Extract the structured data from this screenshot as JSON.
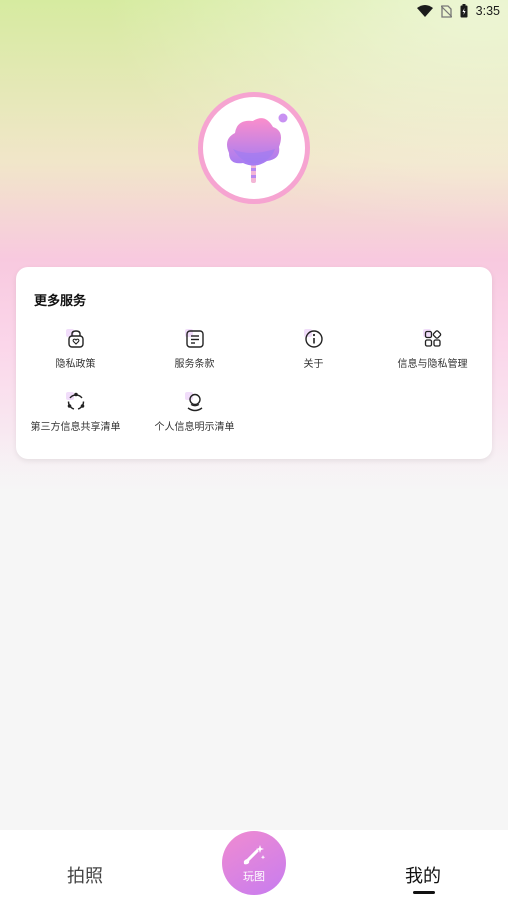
{
  "status_bar": {
    "time": "3:35"
  },
  "services": {
    "title": "更多服务",
    "items": [
      {
        "label": "隐私政策",
        "icon": "privacy-policy-icon"
      },
      {
        "label": "服务条款",
        "icon": "terms-document-icon"
      },
      {
        "label": "关于",
        "icon": "info-icon"
      },
      {
        "label": "信息与隐私管理",
        "icon": "apps-grid-icon"
      },
      {
        "label": "第三方信息共享清单",
        "icon": "share-circle-icon"
      },
      {
        "label": "个人信息明示清单",
        "icon": "person-icon"
      }
    ]
  },
  "tabbar": {
    "photo_label": "拍照",
    "play_label": "玩图",
    "mine_label": "我的",
    "active": "我的"
  },
  "colors": {
    "accent_pink": "#f6a4d1",
    "accent_purple": "#c77cf0"
  }
}
